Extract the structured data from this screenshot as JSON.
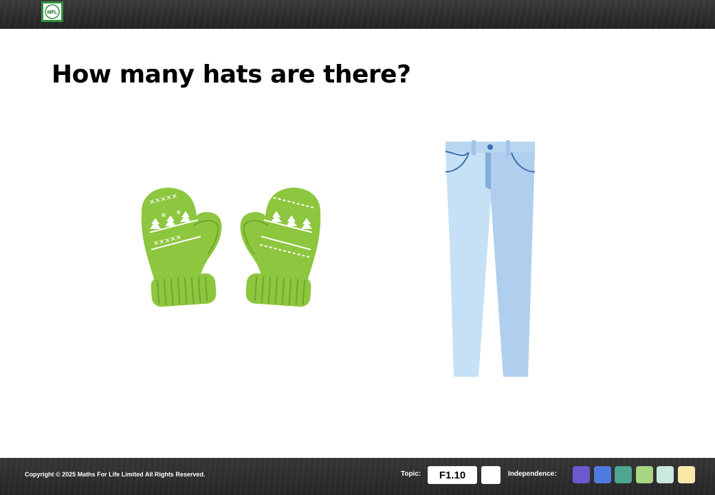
{
  "header": {
    "logo_text": "MFL"
  },
  "question": {
    "title": "How many hats are there?"
  },
  "items": [
    {
      "name": "mittens",
      "color": "#8dc63f"
    },
    {
      "name": "jeans",
      "color": "#b8d6ef"
    }
  ],
  "footer": {
    "copyright": "Copyright © 2025 Maths For Life Limited All Rights Reserved.",
    "topic_label": "Topic:",
    "topic_value": "F1.10",
    "independence_label": "Independence:",
    "independence_colors": [
      "#6a5acd",
      "#4f7be0",
      "#4fa58f",
      "#a8d580",
      "#c8e8e0",
      "#fbe7a8"
    ]
  }
}
